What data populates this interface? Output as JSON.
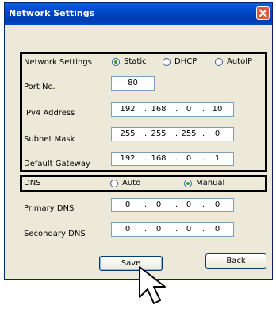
{
  "window": {
    "title": "Network Settings"
  },
  "network": {
    "label": "Network Settings",
    "options": [
      {
        "label": "Static",
        "selected": true
      },
      {
        "label": "DHCP",
        "selected": false
      },
      {
        "label": "AutoIP",
        "selected": false
      }
    ],
    "port_label": "Port No.",
    "port_value": "80",
    "ipv4_label": "IPv4 Address",
    "ipv4": [
      "192",
      "168",
      "0",
      "10"
    ],
    "subnet_label": "Subnet Mask",
    "subnet": [
      "255",
      "255",
      "255",
      "0"
    ],
    "gateway_label": "Default Gateway",
    "gateway": [
      "192",
      "168",
      "0",
      "1"
    ]
  },
  "dns": {
    "label": "DNS",
    "options": [
      {
        "label": "Auto",
        "selected": false
      },
      {
        "label": "Manual",
        "selected": true
      }
    ],
    "primary_label": "Primary DNS",
    "primary": [
      "0",
      "0",
      "0",
      "0"
    ],
    "secondary_label": "Secondary DNS",
    "secondary": [
      "0",
      "0",
      "0",
      "0"
    ]
  },
  "buttons": {
    "save": "Save",
    "back": "Back"
  },
  "icons": {
    "close": "close-icon",
    "cursor": "mouse-pointer-icon"
  }
}
